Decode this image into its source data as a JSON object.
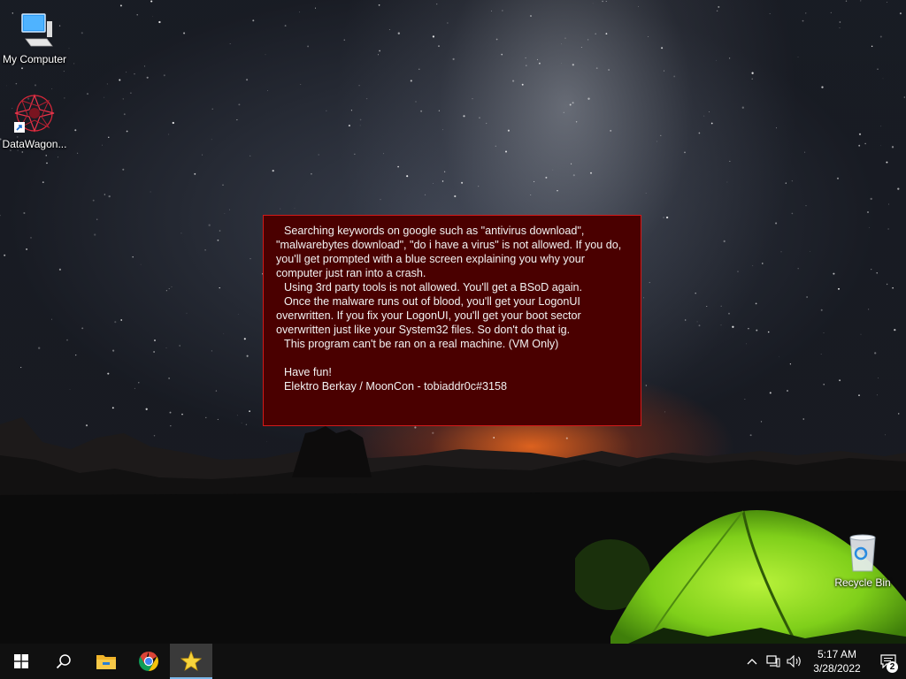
{
  "desktop": {
    "icons": [
      {
        "label": "My Computer",
        "icon": "computer-icon"
      },
      {
        "label": "DataWagon...",
        "icon": "datawagon-icon"
      },
      {
        "label": "Recycle Bin",
        "icon": "recycle-bin-icon"
      }
    ]
  },
  "message": {
    "lines": [
      "Searching keywords on google such as \"antivirus download\", \"malwarebytes download\", \"do i have a virus\" is not allowed. If you do, you'll get prompted with a blue screen explaining you why your computer just ran into a crash.",
      "Using 3rd party tools is not allowed. You'll get a BSoD again.",
      "Once the malware runs out of blood, you'll get your LogonUI overwritten. If you fix your LogonUI, you'll get your boot sector overwritten just like your System32 files. So don't do that ig.",
      "This program can't be ran on a real machine. (VM Only)",
      "Have fun!",
      "Elektro Berkay / MoonCon - tobiaddr0c#3158"
    ],
    "background": "#4a0000",
    "border": "#d21a1a"
  },
  "taskbar": {
    "buttons": [
      {
        "icon": "windows-start-icon"
      },
      {
        "icon": "search-icon"
      },
      {
        "icon": "file-explorer-icon"
      },
      {
        "icon": "chrome-icon"
      },
      {
        "icon": "star-app-icon",
        "active": true
      }
    ],
    "tray": {
      "time": "5:17 AM",
      "date": "3/28/2022",
      "notification_count": "2"
    }
  }
}
